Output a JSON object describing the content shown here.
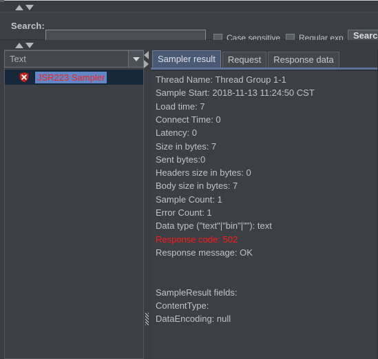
{
  "window": {
    "theme_bg": "#393d42",
    "panel_bg": "#3c4045",
    "accent": "#5e7199",
    "error_color": "#ff1a1a"
  },
  "search_bar": {
    "label": "Search:",
    "input_value": "",
    "input_placeholder": "",
    "case_sensitive_label": "Case sensitive",
    "case_sensitive_checked": false,
    "regular_exp_label": "Regular exp.",
    "regular_exp_checked": false,
    "search_button_label": "Search"
  },
  "tree_panel": {
    "type_selector_value": "Text",
    "type_selector_options": [
      "Text"
    ],
    "nodes": [
      {
        "label": "JSR223 Sampler",
        "icon": "error-shield-icon",
        "selected": true,
        "label_color": "#f62019",
        "highlight_color": "#6287c8"
      }
    ]
  },
  "content_panel": {
    "tabs": [
      {
        "label": "Sampler result",
        "selected": true
      },
      {
        "label": "Request",
        "selected": false
      },
      {
        "label": "Response data",
        "selected": false
      }
    ],
    "sampler_result_lines": [
      {
        "text": "Thread Name: Thread Group 1-1",
        "error": false
      },
      {
        "text": "Sample Start: 2018-11-13 11:24:50 CST",
        "error": false
      },
      {
        "text": "Load time: 7",
        "error": false
      },
      {
        "text": "Connect Time: 0",
        "error": false
      },
      {
        "text": "Latency: 0",
        "error": false
      },
      {
        "text": "Size in bytes: 7",
        "error": false
      },
      {
        "text": "Sent bytes:0",
        "error": false
      },
      {
        "text": "Headers size in bytes: 0",
        "error": false
      },
      {
        "text": "Body size in bytes: 7",
        "error": false
      },
      {
        "text": "Sample Count: 1",
        "error": false
      },
      {
        "text": "Error Count: 1",
        "error": false
      },
      {
        "text": "Data type (\"text\"|\"bin\"|\"\"): text",
        "error": false
      },
      {
        "text": "Response code: 502",
        "error": true
      },
      {
        "text": "Response message: OK",
        "error": false
      },
      {
        "text": "",
        "error": false
      },
      {
        "text": "",
        "error": false
      },
      {
        "text": "SampleResult fields:",
        "error": false
      },
      {
        "text": "ContentType:",
        "error": false
      },
      {
        "text": "DataEncoding: null",
        "error": false
      }
    ]
  }
}
